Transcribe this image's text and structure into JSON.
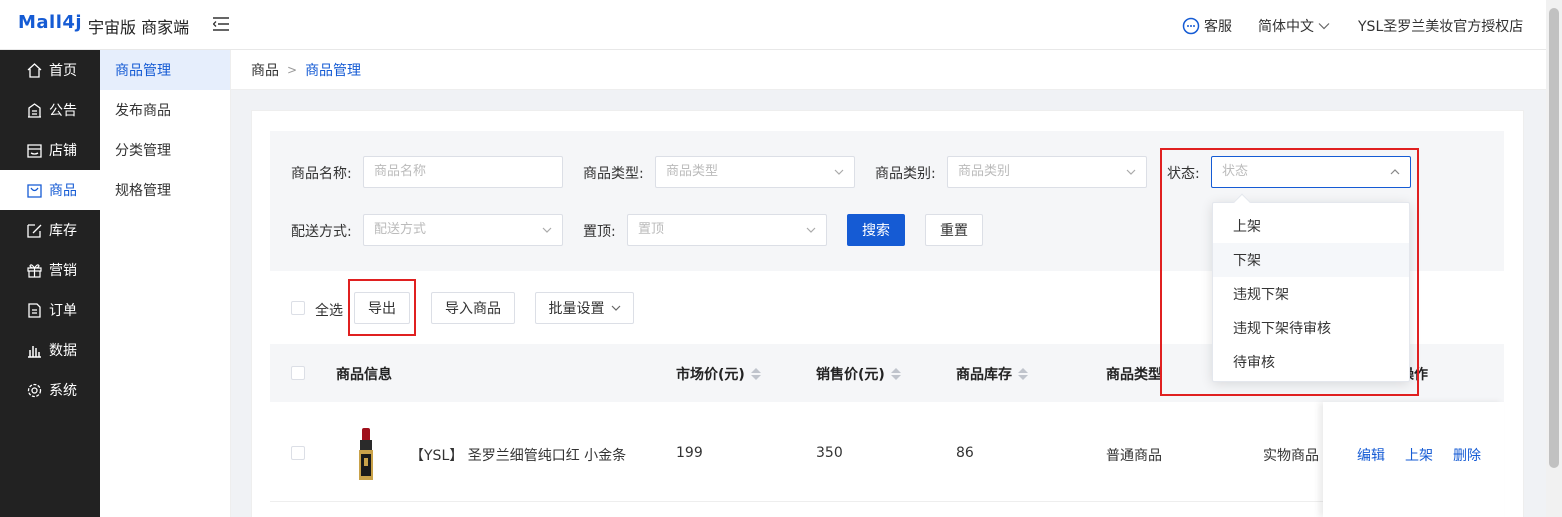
{
  "header": {
    "logo": "Mall4j",
    "brand": "宇宙版 商家端",
    "service": "客服",
    "language": "简体中文",
    "shop_name": "YSL圣罗兰美妆官方授权店"
  },
  "sidebar": {
    "items": [
      {
        "label": "首页",
        "icon": "home-icon"
      },
      {
        "label": "公告",
        "icon": "notice-icon"
      },
      {
        "label": "店铺",
        "icon": "store-icon"
      },
      {
        "label": "商品",
        "icon": "bag-icon"
      },
      {
        "label": "库存",
        "icon": "edit-icon"
      },
      {
        "label": "营销",
        "icon": "gift-icon"
      },
      {
        "label": "订单",
        "icon": "document-icon"
      },
      {
        "label": "数据",
        "icon": "bar-chart-icon"
      },
      {
        "label": "系统",
        "icon": "gear-icon"
      }
    ]
  },
  "submenu": {
    "items": [
      {
        "label": "商品管理"
      },
      {
        "label": "发布商品"
      },
      {
        "label": "分类管理"
      },
      {
        "label": "规格管理"
      }
    ]
  },
  "breadcrumb": {
    "parent": "商品",
    "current": "商品管理"
  },
  "filter": {
    "name_label": "商品名称:",
    "name_placeholder": "商品名称",
    "type_label": "商品类型:",
    "type_placeholder": "商品类型",
    "category_label": "商品类别:",
    "category_placeholder": "商品类别",
    "status_label": "状态:",
    "status_placeholder": "状态",
    "delivery_label": "配送方式:",
    "delivery_placeholder": "配送方式",
    "top_label": "置顶:",
    "top_placeholder": "置顶",
    "search_button": "搜索",
    "reset_button": "重置"
  },
  "status_dropdown": {
    "options": [
      "上架",
      "下架",
      "违规下架",
      "违规下架待审核",
      "待审核"
    ]
  },
  "toolbar": {
    "select_all": "全选",
    "export": "导出",
    "import": "导入商品",
    "batch": "批量设置"
  },
  "table": {
    "headers": {
      "info": "商品信息",
      "market_price": "市场价(元)",
      "sale_price": "销售价(元)",
      "stock": "商品库存",
      "type": "商品类型",
      "action": "操作"
    },
    "rows": [
      {
        "name": "【YSL】 圣罗兰细管纯口红 小金条",
        "market_price": "199",
        "sale_price": "350",
        "stock": "86",
        "type": "普通商品",
        "category": "实物商品",
        "edit": "编辑",
        "online": "上架",
        "delete": "删除"
      }
    ]
  },
  "colors": {
    "primary": "#155bd4",
    "highlight_box": "#e02020"
  }
}
